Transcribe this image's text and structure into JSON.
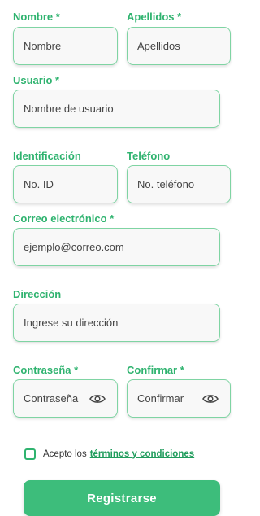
{
  "form": {
    "nombre": {
      "label": "Nombre *",
      "placeholder": "Nombre"
    },
    "apellidos": {
      "label": "Apellidos *",
      "placeholder": "Apellidos"
    },
    "usuario": {
      "label": "Usuario *",
      "placeholder": "Nombre de usuario"
    },
    "identificacion": {
      "label": "Identificación",
      "placeholder": "No. ID"
    },
    "telefono": {
      "label": "Teléfono",
      "placeholder": "No. teléfono"
    },
    "correo": {
      "label": "Correo electrónico *",
      "placeholder": "ejemplo@correo.com"
    },
    "direccion": {
      "label": "Dirección",
      "placeholder": "Ingrese su dirección"
    },
    "contrasena": {
      "label": "Contraseña *",
      "placeholder": "Contraseña",
      "icon": "eye-icon"
    },
    "confirmar": {
      "label": "Confirmar *",
      "placeholder": "Confirmar",
      "icon": "eye-icon"
    }
  },
  "terms": {
    "prefix": "Acepto los",
    "link": "términos y condiciones",
    "checked": false
  },
  "submit_label": "Registrarse",
  "colors": {
    "accent": "#2fb36f",
    "button": "#3dbd7b",
    "field_border": "#7fd4a3"
  }
}
